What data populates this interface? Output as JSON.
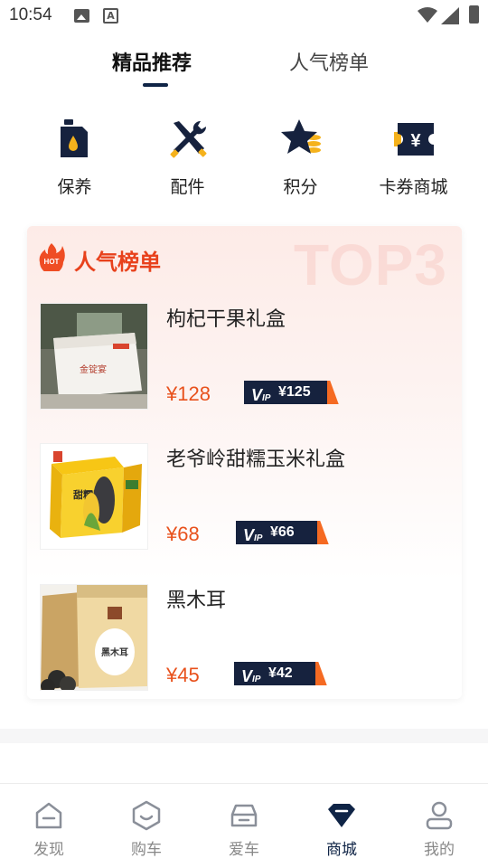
{
  "status_bar": {
    "time": "10:54",
    "letter_icon": "A"
  },
  "tabs": [
    {
      "label": "精品推荐",
      "active": true
    },
    {
      "label": "人气榜单",
      "active": false
    }
  ],
  "categories": [
    {
      "label": "保养",
      "icon": "oil-can-icon"
    },
    {
      "label": "配件",
      "icon": "tools-icon"
    },
    {
      "label": "积分",
      "icon": "star-coins-icon"
    },
    {
      "label": "卡券商城",
      "icon": "yen-ticket-icon"
    }
  ],
  "ranking": {
    "hot_badge": "HOT",
    "title": "人气榜单",
    "watermark": "TOP3",
    "products": [
      {
        "name": "枸杞干果礼盒",
        "price": "¥128",
        "vip_price": "¥125"
      },
      {
        "name": "老爷岭甜糯玉米礼盒",
        "price": "¥68",
        "vip_price": "¥66"
      },
      {
        "name": "黑木耳",
        "price": "¥45",
        "vip_price": "¥42"
      }
    ],
    "product_image_text": {
      "gift_box": "金锭宴",
      "corn_box": "甜糯玉米",
      "fungus_bag": "黑木耳"
    }
  },
  "vip_mark": {
    "v": "V",
    "ip": "IP"
  },
  "bottom_nav": [
    {
      "label": "发现",
      "icon": "discover-icon",
      "active": false
    },
    {
      "label": "购车",
      "icon": "buy-car-icon",
      "active": false
    },
    {
      "label": "爱车",
      "icon": "my-car-icon",
      "active": false
    },
    {
      "label": "商城",
      "icon": "mall-icon",
      "active": true
    },
    {
      "label": "我的",
      "icon": "profile-icon",
      "active": false
    }
  ],
  "colors": {
    "brand_navy": "#0f2446",
    "accent_orange": "#e8511c",
    "hot_red": "#e8411c",
    "vip_tail": "#f56a22"
  }
}
